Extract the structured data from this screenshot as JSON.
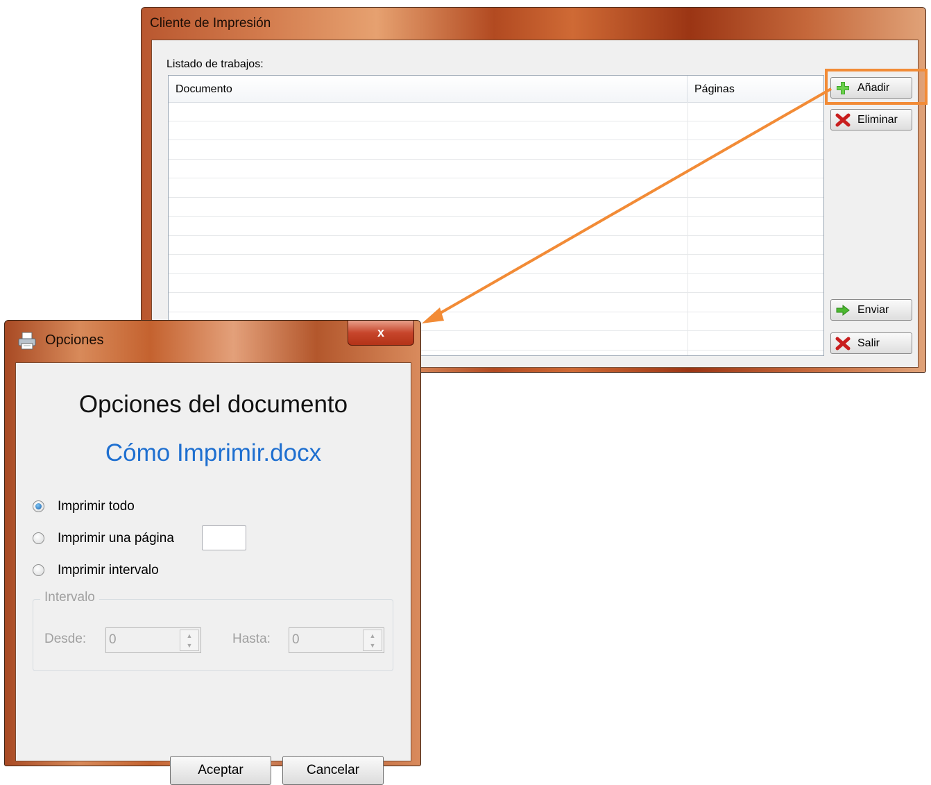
{
  "main_window": {
    "title": "Cliente de Impresión",
    "list_label": "Listado de trabajos:",
    "columns": [
      "Documento",
      "Páginas"
    ],
    "buttons": {
      "add": {
        "label": "Añadir",
        "icon": "plus-icon"
      },
      "delete": {
        "label": "Eliminar",
        "icon": "red-x-icon"
      },
      "send": {
        "label": "Enviar",
        "icon": "green-arrow-icon"
      },
      "exit": {
        "label": "Salir",
        "icon": "red-x-icon"
      }
    }
  },
  "dialog": {
    "title": "Opciones",
    "close_glyph": "x",
    "heading": "Opciones del documento",
    "filename": "Cómo Imprimir.docx",
    "options": {
      "all": {
        "label": "Imprimir todo",
        "selected": true
      },
      "single": {
        "label": "Imprimir una página",
        "selected": false,
        "value": ""
      },
      "range": {
        "label": "Imprimir intervalo",
        "selected": false
      }
    },
    "interval": {
      "legend": "Intervalo",
      "from_label": "Desde:",
      "from_value": "0",
      "to_label": "Hasta:",
      "to_value": "0"
    },
    "buttons": {
      "ok": "Aceptar",
      "cancel": "Cancelar"
    }
  },
  "annotation": {
    "highlight_color": "#f28b36",
    "arrow_color": "#f28b36"
  }
}
